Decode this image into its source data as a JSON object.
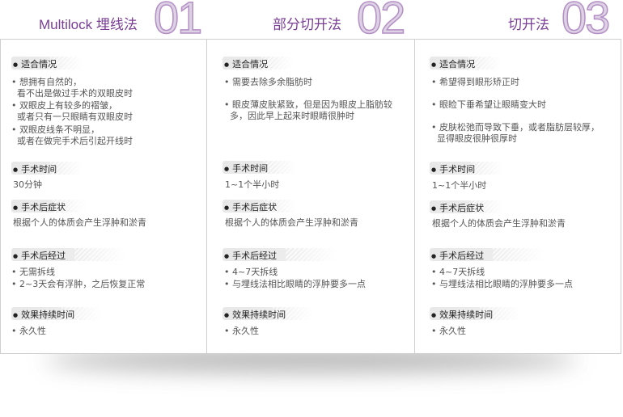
{
  "columns": [
    {
      "title": "Multilock 埋线法",
      "number": "01",
      "sections": {
        "indication": {
          "label": "适合情况",
          "items": [
            "• 想拥有自然的，",
            "  看不出是做过手术的双眼皮时",
            "• 双眼皮上有较多的褶皱，",
            "  或者只有一只眼睛有双眼皮时",
            "• 双眼皮线条不明显，",
            "  或者在做完手术后引起开线时"
          ]
        },
        "duration": {
          "label": "手术时间",
          "value": "30分钟"
        },
        "symptoms": {
          "label": "手术后症状",
          "value": "根据个人的体质会产生浮肿和淤青"
        },
        "recovery": {
          "label": "手术后经过",
          "items": [
            "• 无需拆线",
            "• 2~3天会有浮肿，之后恢复正常"
          ]
        },
        "effect": {
          "label": "效果持续时间",
          "value": "• 永久性"
        }
      }
    },
    {
      "title": "部分切开法",
      "number": "02",
      "sections": {
        "indication": {
          "label": "适合情况",
          "items": [
            "• 需要去除多余脂肪时",
            "• 眼皮薄皮肤紧致，但是因为眼皮上脂肪较",
            "  多，因此早上起来时眼睛很肿时"
          ]
        },
        "duration": {
          "label": "手术时间",
          "value": "1~1个半小时"
        },
        "symptoms": {
          "label": "手术后症状",
          "value": "根据个人的体质会产生浮肿和淤青"
        },
        "recovery": {
          "label": "手术后经过",
          "items": [
            "• 4~7天拆线",
            "• 与埋线法相比眼睛的浮肿要多一点"
          ]
        },
        "effect": {
          "label": "效果持续时间",
          "value": "• 永久性"
        }
      }
    },
    {
      "title": "切开法",
      "number": "03",
      "sections": {
        "indication": {
          "label": "适合情况",
          "items": [
            "• 希望得到眼形矫正时",
            "• 眼睑下垂希望让眼睛变大时",
            "• 皮肤松弛而导致下垂，或者脂肪层较厚，",
            "  显得眼皮很肿很厚时"
          ]
        },
        "duration": {
          "label": "手术时间",
          "value": "1~1个半小时"
        },
        "symptoms": {
          "label": "手术后症状",
          "value": "根据个人的体质会产生浮肿和淤青"
        },
        "recovery": {
          "label": "手术后经过",
          "items": [
            "• 4~7天拆线",
            "• 与埋线法相比眼睛的浮肿要多一点"
          ]
        },
        "effect": {
          "label": "效果持续时间",
          "value": "• 永久性"
        }
      }
    }
  ],
  "colors": {
    "title": "#7a3d95",
    "number_fill": "#ddd2e3",
    "border": "#cfcfcf"
  }
}
